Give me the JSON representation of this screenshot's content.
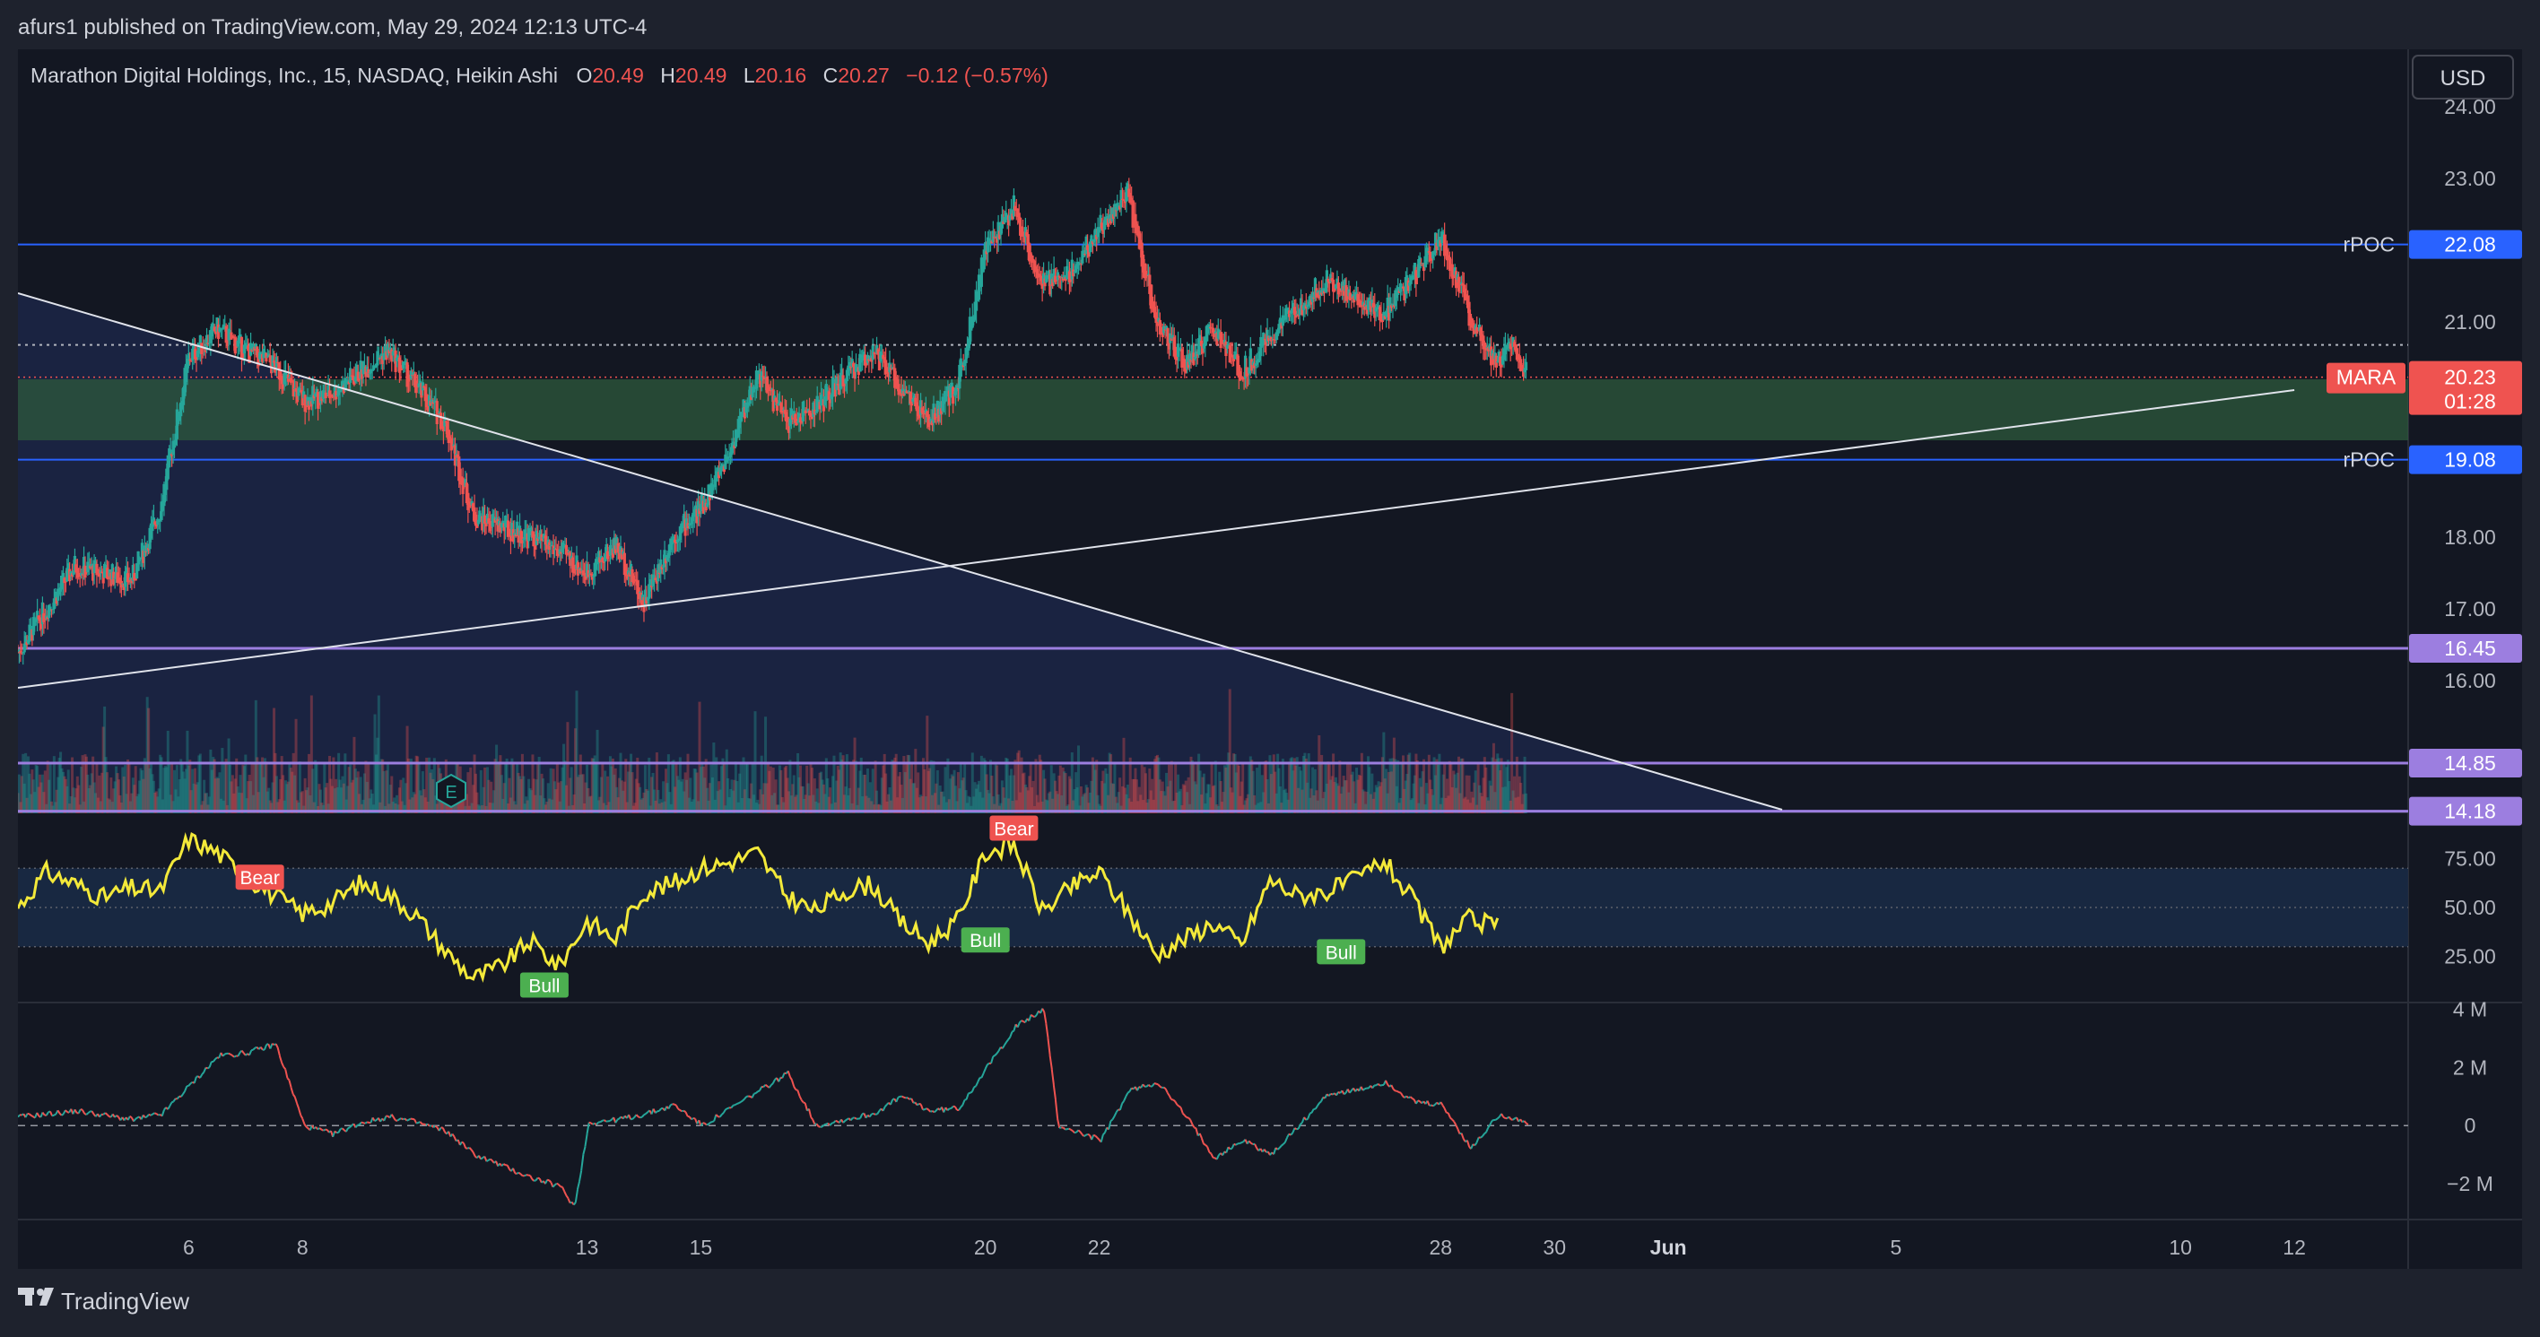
{
  "publish_header": "afurs1 published on TradingView.com, May 29, 2024 12:13 UTC-4",
  "footer_brand": "TradingView",
  "currency": "USD",
  "colors": {
    "background": "#131722",
    "frame": "#1e222d",
    "up": "#26a69a",
    "down": "#ef5350",
    "rpoc": "#2962ff",
    "level": "#9c7ee0",
    "trendline": "#e0e3eb",
    "rsi": "#f3e93a",
    "zone": "#2e5a3c",
    "bull_label": "#4caf50",
    "bear_label": "#ef5350"
  },
  "chart_data": {
    "type": "candlestick",
    "symbol": "Marathon Digital Holdings, Inc., 15, NASDAQ, Heikin Ashi",
    "ohlc": {
      "o_label": "O",
      "o": "20.49",
      "h_label": "H",
      "h": "20.49",
      "l_label": "L",
      "l": "20.16",
      "c_label": "C",
      "c": "20.27",
      "change": "−0.12 (−0.57%)"
    },
    "last_price": {
      "ticker": "MARA",
      "price": "20.23",
      "countdown": "01:28",
      "value": 20.23
    },
    "price_axis": {
      "ticks": [
        "24.00",
        "23.00",
        "21.00",
        "18.00",
        "17.00",
        "16.00"
      ],
      "ylim": [
        14.15,
        24.8
      ]
    },
    "time_axis": {
      "labels": [
        "6",
        "8",
        "13",
        "15",
        "20",
        "22",
        "28",
        "30",
        "Jun",
        "5",
        "10",
        "12"
      ],
      "range": [
        "2024-05-03",
        "2024-06-14"
      ]
    },
    "horizontal_levels": [
      {
        "label": "rPOC",
        "value": 22.08,
        "text": "22.08"
      },
      {
        "label": "rPOC",
        "value": 19.08,
        "text": "19.08"
      },
      {
        "label": "",
        "value": 16.45,
        "text": "16.45"
      },
      {
        "label": "",
        "value": 14.85,
        "text": "14.85"
      },
      {
        "label": "",
        "value": 14.18,
        "text": "14.18"
      }
    ],
    "zone": {
      "top": 20.2,
      "bottom": 19.35
    },
    "trendlines": [
      {
        "from": [
          "2024-05-03",
          21.4
        ],
        "to": [
          "2024-06-03",
          14.2
        ]
      },
      {
        "from": [
          "2024-05-03",
          15.9
        ],
        "to": [
          "2024-06-12",
          20.05
        ]
      }
    ],
    "price_series": [
      [
        "2024-05-03",
        16.4
      ],
      [
        "2024-05-04",
        17.6
      ],
      [
        "2024-05-05",
        17.4
      ],
      [
        "2024-05-05T12",
        18.4
      ],
      [
        "2024-05-06",
        20.5
      ],
      [
        "2024-05-06T12",
        20.9
      ],
      [
        "2024-05-07",
        20.6
      ],
      [
        "2024-05-07T12",
        20.4
      ],
      [
        "2024-05-08",
        19.9
      ],
      [
        "2024-05-08T12",
        20.0
      ],
      [
        "2024-05-09",
        20.3
      ],
      [
        "2024-05-09T12",
        20.6
      ],
      [
        "2024-05-10",
        20.1
      ],
      [
        "2024-05-10T12",
        19.6
      ],
      [
        "2024-05-11",
        18.3
      ],
      [
        "2024-05-12",
        18.0
      ],
      [
        "2024-05-12T12",
        17.8
      ],
      [
        "2024-05-13",
        17.5
      ],
      [
        "2024-05-13T12",
        17.9
      ],
      [
        "2024-05-14",
        17.1
      ],
      [
        "2024-05-14T12",
        18.0
      ],
      [
        "2024-05-15",
        18.4
      ],
      [
        "2024-05-15T12",
        19.2
      ],
      [
        "2024-05-16",
        20.3
      ],
      [
        "2024-05-16T12",
        19.6
      ],
      [
        "2024-05-17",
        19.8
      ],
      [
        "2024-05-18",
        20.6
      ],
      [
        "2024-05-19",
        19.6
      ],
      [
        "2024-05-19T12",
        20.1
      ],
      [
        "2024-05-20",
        22.0
      ],
      [
        "2024-05-20T12",
        22.6
      ],
      [
        "2024-05-21",
        21.5
      ],
      [
        "2024-05-21T12",
        21.7
      ],
      [
        "2024-05-22",
        22.3
      ],
      [
        "2024-05-22T12",
        22.8
      ],
      [
        "2024-05-23",
        21.0
      ],
      [
        "2024-05-23T12",
        20.4
      ],
      [
        "2024-05-24",
        20.9
      ],
      [
        "2024-05-24T12",
        20.3
      ],
      [
        "2024-05-25",
        20.8
      ],
      [
        "2024-05-26",
        21.6
      ],
      [
        "2024-05-27",
        21.1
      ],
      [
        "2024-05-27T12",
        21.6
      ],
      [
        "2024-05-28",
        22.2
      ],
      [
        "2024-05-28T12",
        21.1
      ],
      [
        "2024-05-29",
        20.4
      ],
      [
        "2024-05-29T06",
        20.8
      ],
      [
        "2024-05-29T12",
        20.27
      ]
    ],
    "volume_profile_max": 1.0,
    "rsi": {
      "ticks": [
        "75.00",
        "50.00",
        "25.00"
      ],
      "ylim": [
        2,
        98
      ],
      "band": [
        30,
        70
      ],
      "series": [
        [
          "2024-05-03",
          50
        ],
        [
          "2024-05-03T12",
          68
        ],
        [
          "2024-05-04",
          62
        ],
        [
          "2024-05-04T12",
          55
        ],
        [
          "2024-05-05",
          60
        ],
        [
          "2024-05-05T12",
          58
        ],
        [
          "2024-05-06",
          85
        ],
        [
          "2024-05-06T12",
          78
        ],
        [
          "2024-05-07",
          66
        ],
        [
          "2024-05-07T12",
          56
        ],
        [
          "2024-05-08",
          47
        ],
        [
          "2024-05-08T12",
          52
        ],
        [
          "2024-05-09",
          62
        ],
        [
          "2024-05-09T12",
          57
        ],
        [
          "2024-05-10",
          46
        ],
        [
          "2024-05-10T12",
          28
        ],
        [
          "2024-05-11",
          14
        ],
        [
          "2024-05-11T12",
          20
        ],
        [
          "2024-05-12",
          33
        ],
        [
          "2024-05-12T12",
          20
        ],
        [
          "2024-05-13",
          43
        ],
        [
          "2024-05-13T12",
          34
        ],
        [
          "2024-05-14",
          58
        ],
        [
          "2024-05-14T12",
          62
        ],
        [
          "2024-05-15",
          70
        ],
        [
          "2024-05-15T12",
          73
        ],
        [
          "2024-05-16",
          78
        ],
        [
          "2024-05-16T12",
          56
        ],
        [
          "2024-05-17",
          48
        ],
        [
          "2024-05-17T12",
          58
        ],
        [
          "2024-05-18",
          62
        ],
        [
          "2024-05-18T12",
          43
        ],
        [
          "2024-05-19",
          32
        ],
        [
          "2024-05-19T12",
          43
        ],
        [
          "2024-05-20",
          78
        ],
        [
          "2024-05-20T12",
          82
        ],
        [
          "2024-05-21",
          48
        ],
        [
          "2024-05-21T12",
          60
        ],
        [
          "2024-05-22",
          68
        ],
        [
          "2024-05-22T12",
          48
        ],
        [
          "2024-05-23",
          26
        ],
        [
          "2024-05-23T12",
          34
        ],
        [
          "2024-05-24",
          42
        ],
        [
          "2024-05-24T12",
          31
        ],
        [
          "2024-05-25",
          64
        ],
        [
          "2024-05-25T12",
          56
        ],
        [
          "2024-05-26",
          58
        ],
        [
          "2024-05-26T12",
          64
        ],
        [
          "2024-05-27",
          74
        ],
        [
          "2024-05-27T12",
          54
        ],
        [
          "2024-05-28",
          30
        ],
        [
          "2024-05-28T12",
          44
        ],
        [
          "2024-05-29",
          40
        ]
      ],
      "labels": [
        {
          "text": "Bear",
          "at": [
            "2024-05-07T06",
            65
          ]
        },
        {
          "text": "Bear",
          "at": [
            "2024-05-20T12",
            90
          ]
        },
        {
          "text": "Bull",
          "at": [
            "2024-05-12T06",
            10
          ]
        },
        {
          "text": "Bull",
          "at": [
            "2024-05-20",
            33
          ]
        },
        {
          "text": "Bull",
          "at": [
            "2024-05-26T06",
            27
          ]
        }
      ]
    },
    "volume_delta": {
      "ticks": [
        "4 M",
        "2 M",
        "0",
        "−2 M"
      ],
      "ylim": [
        -3.2,
        4.2
      ],
      "series": [
        [
          "2024-05-03",
          0.3
        ],
        [
          "2024-05-04",
          0.5
        ],
        [
          "2024-05-05",
          0.2
        ],
        [
          "2024-05-05T12",
          0.4
        ],
        [
          "2024-05-06",
          1.4
        ],
        [
          "2024-05-06T12",
          2.4
        ],
        [
          "2024-05-07",
          2.5
        ],
        [
          "2024-05-07T12",
          2.8
        ],
        [
          "2024-05-08",
          0.0
        ],
        [
          "2024-05-08T12",
          -0.3
        ],
        [
          "2024-05-09",
          0.1
        ],
        [
          "2024-05-09T12",
          0.3
        ],
        [
          "2024-05-10",
          0.1
        ],
        [
          "2024-05-10T12",
          -0.2
        ],
        [
          "2024-05-11",
          -1.0
        ],
        [
          "2024-05-12",
          -1.8
        ],
        [
          "2024-05-12T12",
          -2.1
        ],
        [
          "2024-05-12T18",
          -2.8
        ],
        [
          "2024-05-13",
          0.1
        ],
        [
          "2024-05-13T12",
          0.2
        ],
        [
          "2024-05-14",
          0.4
        ],
        [
          "2024-05-14T12",
          0.7
        ],
        [
          "2024-05-15",
          0.0
        ],
        [
          "2024-05-15T12",
          0.6
        ],
        [
          "2024-05-16",
          1.2
        ],
        [
          "2024-05-16T12",
          1.8
        ],
        [
          "2024-05-17",
          0.0
        ],
        [
          "2024-05-17T12",
          0.2
        ],
        [
          "2024-05-18",
          0.4
        ],
        [
          "2024-05-18T12",
          1.0
        ],
        [
          "2024-05-19",
          0.5
        ],
        [
          "2024-05-19T12",
          0.6
        ],
        [
          "2024-05-20",
          2.0
        ],
        [
          "2024-05-20T12",
          3.4
        ],
        [
          "2024-05-21",
          4.0
        ],
        [
          "2024-05-21T06",
          0.0
        ],
        [
          "2024-05-22",
          -0.5
        ],
        [
          "2024-05-22T12",
          1.2
        ],
        [
          "2024-05-23",
          1.5
        ],
        [
          "2024-05-23T12",
          0.3
        ],
        [
          "2024-05-24",
          -1.1
        ],
        [
          "2024-05-24T12",
          -0.5
        ],
        [
          "2024-05-25",
          -1.0
        ],
        [
          "2024-05-26",
          1.1
        ],
        [
          "2024-05-26T12",
          1.2
        ],
        [
          "2024-05-27",
          1.5
        ],
        [
          "2024-05-27T12",
          0.8
        ],
        [
          "2024-05-28",
          0.7
        ],
        [
          "2024-05-28T12",
          -0.8
        ],
        [
          "2024-05-29",
          0.4
        ],
        [
          "2024-05-29T12",
          0.1
        ]
      ]
    }
  }
}
